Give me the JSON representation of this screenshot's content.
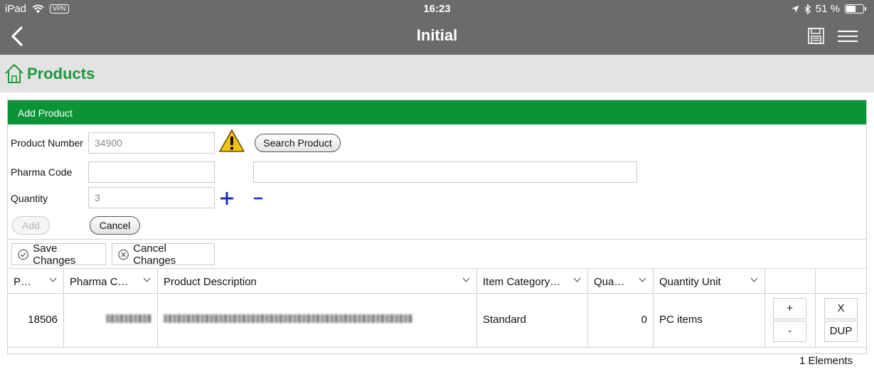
{
  "status_bar": {
    "device": "iPad",
    "vpn": "VPN",
    "time": "16:23",
    "battery": "51 %",
    "battery_level": 0.51
  },
  "nav": {
    "title": "Initial"
  },
  "page": {
    "title": "Products"
  },
  "add_product": {
    "header": "Add Product",
    "product_number_label": "Product Number",
    "product_number_value": "34900",
    "search_button": "Search Product",
    "pharma_code_label": "Pharma Code",
    "pharma_code_value": "",
    "description_value": "",
    "quantity_label": "Quantity",
    "quantity_value": "3",
    "add_button": "Add",
    "cancel_button": "Cancel"
  },
  "toolbar": {
    "save_changes": "Save Changes",
    "cancel_changes": "Cancel Changes"
  },
  "table": {
    "columns": [
      "P…",
      "Pharma C…",
      "Product Description",
      "Item Category…",
      "Qua…",
      "Quantity Unit"
    ],
    "rows": [
      {
        "product": "18506",
        "item_category": "Standard",
        "quantity": "0",
        "quantity_unit": "PC items",
        "plus": "+",
        "minus": "-",
        "delete": "X",
        "duplicate": "DUP"
      }
    ]
  },
  "footer": {
    "count": "1 Elements"
  },
  "colors": {
    "nav_bg": "#6b6b6d",
    "green": "#0a9436",
    "title_green": "#1f9a3a",
    "blue": "#1a2fbf"
  }
}
